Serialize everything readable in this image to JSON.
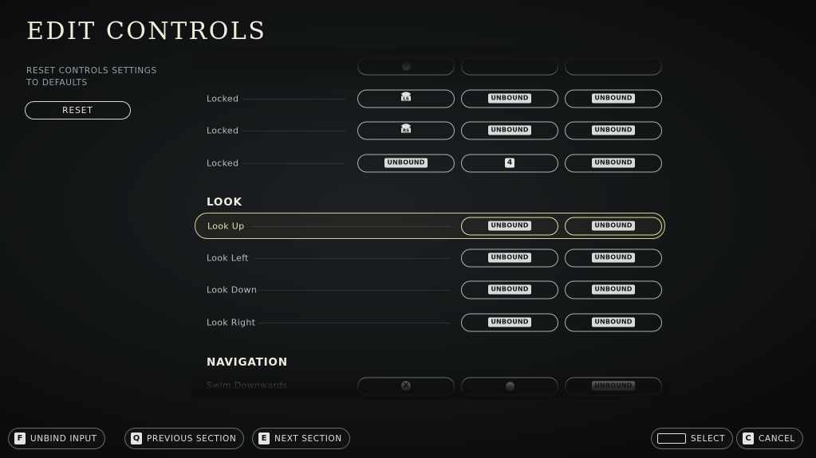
{
  "page": {
    "title": "EDIT CONTROLS",
    "reset_description": "RESET CONTROLS SETTINGS TO DEFAULTS",
    "reset_button": "RESET"
  },
  "bindings": {
    "rows_top": [
      {
        "label": "Locked",
        "slot1": "LS",
        "slot2": "UNBOUND",
        "slot3": "UNBOUND"
      },
      {
        "label": "Locked",
        "slot1": "RS",
        "slot2": "UNBOUND",
        "slot3": "UNBOUND"
      },
      {
        "label": "Locked",
        "slot1": "UNBOUND",
        "slot2": "4",
        "slot3": "UNBOUND"
      }
    ],
    "look_header": "LOOK",
    "look_rows": [
      {
        "label": "Look Up",
        "slot2": "UNBOUND",
        "slot3": "UNBOUND",
        "selected": true
      },
      {
        "label": "Look Left",
        "slot2": "UNBOUND",
        "slot3": "UNBOUND"
      },
      {
        "label": "Look Down",
        "slot2": "UNBOUND",
        "slot3": "UNBOUND"
      },
      {
        "label": "Look Right",
        "slot2": "UNBOUND",
        "slot3": "UNBOUND"
      }
    ],
    "navigation_header": "NAVIGATION",
    "nav_rows": [
      {
        "label": "Swim Downwards",
        "slot1": "X",
        "slot3": "UNBOUND"
      }
    ]
  },
  "footer": {
    "unbind": {
      "key": "F",
      "label": "UNBIND INPUT"
    },
    "previous": {
      "key": "Q",
      "label": "PREVIOUS SECTION"
    },
    "next": {
      "key": "E",
      "label": "NEXT SECTION"
    },
    "select": {
      "key": "space-bar",
      "label": "SELECT"
    },
    "cancel": {
      "key": "C",
      "label": "CANCEL"
    }
  },
  "colors": {
    "accent": "#d8cf9c",
    "background": "#131617",
    "text": "#e8e4d8"
  }
}
